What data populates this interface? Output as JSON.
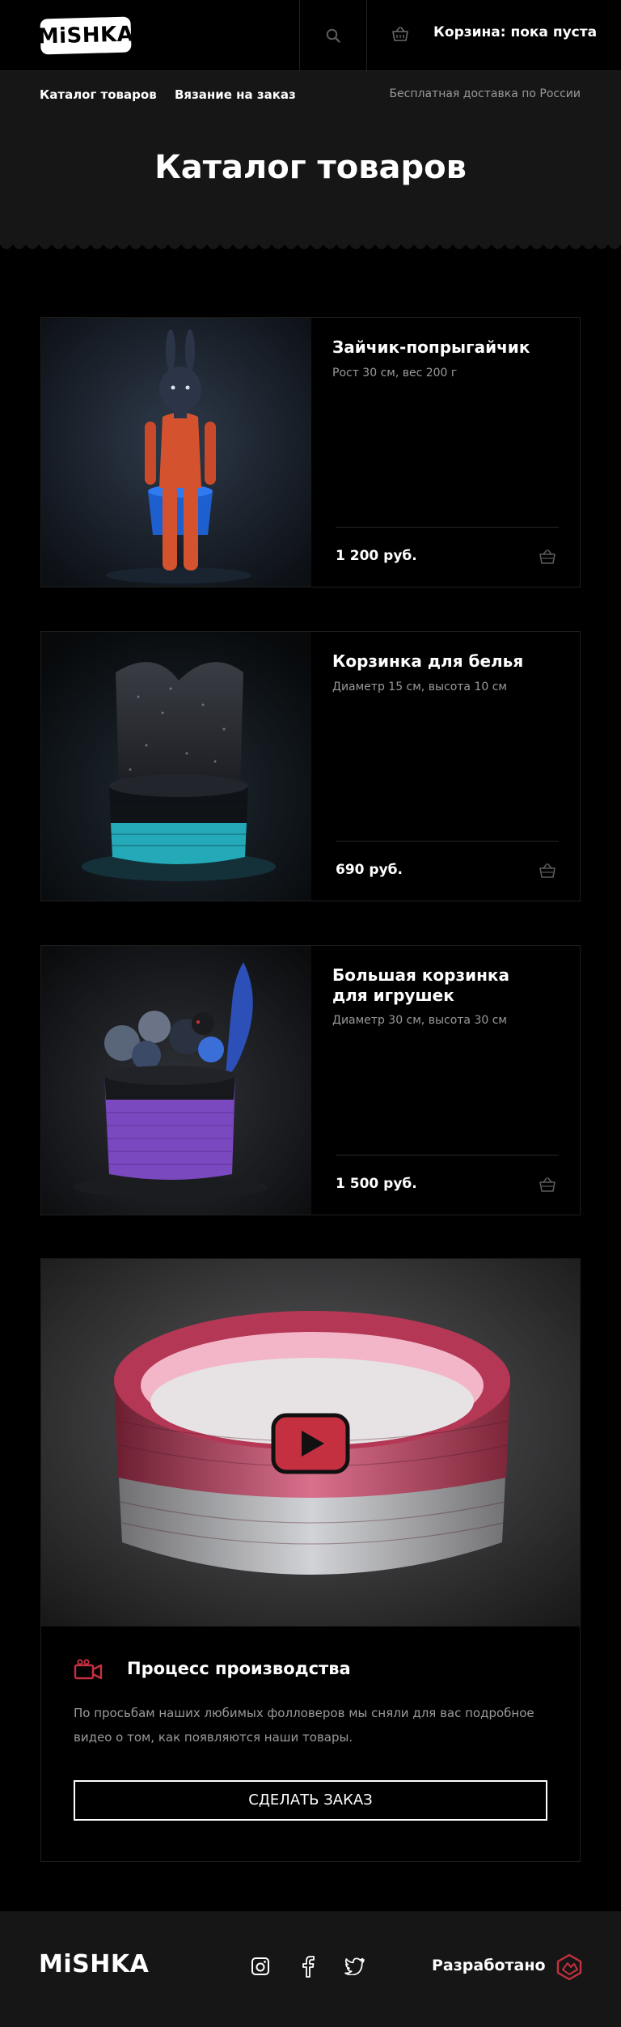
{
  "header": {
    "logo": "MiSHKA",
    "cart_text": "Корзина: пока пуста"
  },
  "nav": {
    "catalog": "Каталог товаров",
    "knitting": "Вязание на заказ",
    "delivery": "Бесплатная доставка по России"
  },
  "hero": {
    "title": "Каталог товаров"
  },
  "products": [
    {
      "title": "Зайчик-попрыгайчик",
      "desc": "Рост 30 см, вес 200 г",
      "price": "1 200 руб."
    },
    {
      "title": "Корзинка для белья",
      "desc": "Диаметр 15 см, высота 10 см",
      "price": "690 руб."
    },
    {
      "title": "Большая корзинка для игрушек",
      "desc": "Диаметр 30 см, высота 30 см",
      "price": "1 500 руб."
    }
  ],
  "video": {
    "title": "Процесс производства",
    "text": "По просьбам наших любимых фолловеров мы сняли для вас подробное видео о том, как появляются наши товары.",
    "button": "СДЕЛАТЬ ЗАКАЗ"
  },
  "footer": {
    "logo": "MiSHKA",
    "dev_label": "Разработано",
    "social_icons": [
      "instagram-icon",
      "facebook-icon",
      "twitter-icon"
    ]
  },
  "colors": {
    "background": "#000000",
    "panel": "#161616",
    "muted_text": "#9a9a9a",
    "accent_red": "#c4303f"
  }
}
